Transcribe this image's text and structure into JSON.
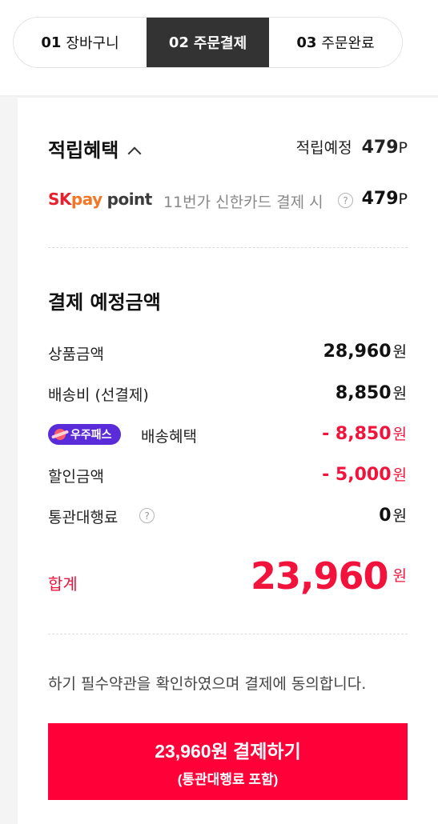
{
  "steps": [
    {
      "num": "01",
      "label": "장바구니"
    },
    {
      "num": "02",
      "label": "주문결제"
    },
    {
      "num": "03",
      "label": "주문완료"
    }
  ],
  "reward": {
    "title": "적립혜택",
    "expected_label": "적립예정",
    "expected_value": "479",
    "expected_unit": "P",
    "skpay": {
      "brand_sk": "SK",
      "brand_pay": "pay",
      "brand_point": "point",
      "condition": "11번가 신한카드 결제 시",
      "value": "479",
      "unit": "P"
    }
  },
  "payment": {
    "title": "결제 예정금액",
    "won": "원",
    "rows": [
      {
        "label": "상품금액",
        "value": "28,960"
      },
      {
        "label": "배송비 (선결제)",
        "value": "8,850"
      },
      {
        "label": "배송혜택",
        "badge": "우주패스",
        "value": "- 8,850"
      },
      {
        "label": "할인금액",
        "value": "- 5,000"
      },
      {
        "label": "통관대행료",
        "value": "0"
      }
    ],
    "total_label": "합계",
    "total_value": "23,960"
  },
  "notice": "하기 필수약관을 확인하였으며 결제에 동의합니다.",
  "pay_button": {
    "main": "23,960원 결제하기",
    "sub": "(통관대행료 포함)"
  },
  "colors": {
    "accent_red": "#f2133c",
    "button_red": "#ff0038",
    "active_step": "#333333",
    "badge_purple": "#5a2bd8"
  }
}
